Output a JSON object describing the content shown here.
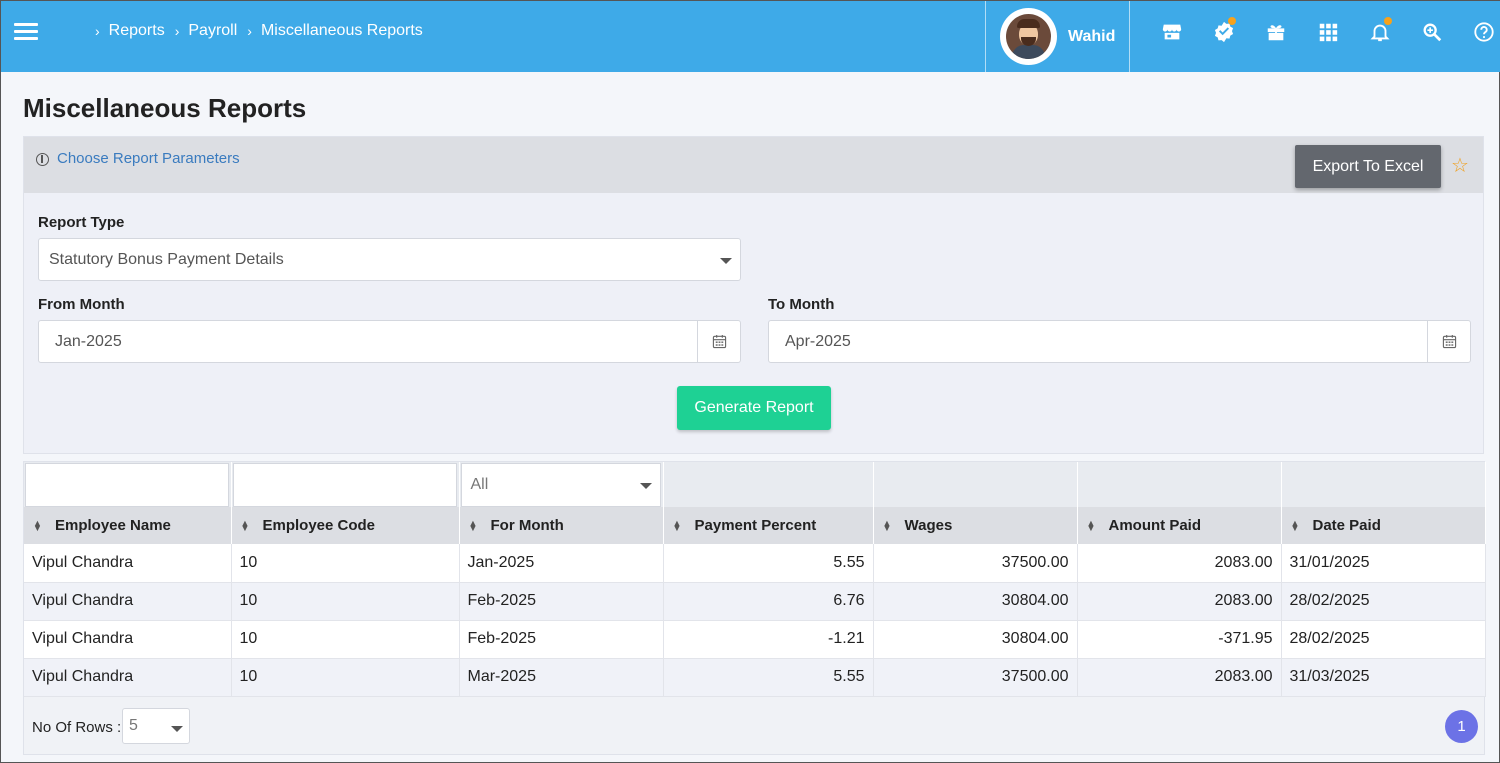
{
  "topbar": {
    "breadcrumb": [
      "Reports",
      "Payroll",
      "Miscellaneous Reports"
    ],
    "username": "Wahid",
    "icons": [
      "store-icon",
      "verified-badge-icon",
      "gift-icon",
      "apps-grid-icon",
      "bell-icon",
      "search-zoom-icon",
      "help-icon"
    ],
    "accent_color": "#3eaae8",
    "notification_dot_color": "#f7a21b"
  },
  "page": {
    "title": "Miscellaneous Reports"
  },
  "params": {
    "choose_label": "Choose Report Parameters",
    "export_label": "Export To Excel",
    "report_type_label": "Report Type",
    "report_type_value": "Statutory Bonus Payment Details",
    "from_month_label": "From Month",
    "from_month_value": "Jan-2025",
    "to_month_label": "To Month",
    "to_month_value": "Apr-2025",
    "generate_label": "Generate Report",
    "generate_color": "#1ed194"
  },
  "grid": {
    "filter_select_value": "All",
    "columns": [
      "Employee Name",
      "Employee Code",
      "For Month",
      "Payment Percent",
      "Wages",
      "Amount Paid",
      "Date Paid"
    ],
    "rows": [
      [
        "Vipul Chandra",
        "10",
        "Jan-2025",
        "5.55",
        "37500.00",
        "2083.00",
        "31/01/2025"
      ],
      [
        "Vipul Chandra",
        "10",
        "Feb-2025",
        "6.76",
        "30804.00",
        "2083.00",
        "28/02/2025"
      ],
      [
        "Vipul Chandra",
        "10",
        "Feb-2025",
        "-1.21",
        "30804.00",
        "-371.95",
        "28/02/2025"
      ],
      [
        "Vipul Chandra",
        "10",
        "Mar-2025",
        "5.55",
        "37500.00",
        "2083.00",
        "31/03/2025"
      ]
    ],
    "rows_label": "No Of Rows :",
    "rows_value": "5",
    "current_page": "1"
  }
}
